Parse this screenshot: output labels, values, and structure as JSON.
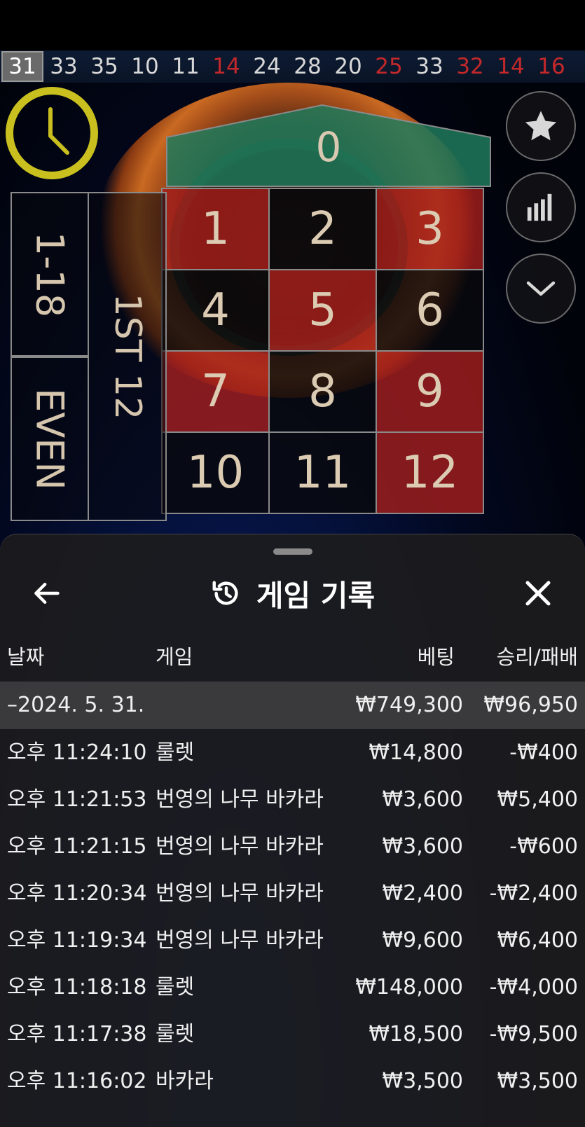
{
  "recent_numbers": [
    {
      "value": "31",
      "color": "current"
    },
    {
      "value": "33",
      "color": "black"
    },
    {
      "value": "35",
      "color": "black"
    },
    {
      "value": "10",
      "color": "black"
    },
    {
      "value": "11",
      "color": "black"
    },
    {
      "value": "14",
      "color": "red"
    },
    {
      "value": "24",
      "color": "black"
    },
    {
      "value": "28",
      "color": "black"
    },
    {
      "value": "20",
      "color": "black"
    },
    {
      "value": "25",
      "color": "red"
    },
    {
      "value": "33",
      "color": "black"
    },
    {
      "value": "32",
      "color": "red"
    },
    {
      "value": "14",
      "color": "red"
    },
    {
      "value": "16",
      "color": "red"
    }
  ],
  "table": {
    "zero": "0",
    "numbers": [
      {
        "n": "1",
        "c": "red"
      },
      {
        "n": "2",
        "c": "black"
      },
      {
        "n": "3",
        "c": "red"
      },
      {
        "n": "4",
        "c": "black"
      },
      {
        "n": "5",
        "c": "red"
      },
      {
        "n": "6",
        "c": "black"
      },
      {
        "n": "7",
        "c": "red"
      },
      {
        "n": "8",
        "c": "black"
      },
      {
        "n": "9",
        "c": "red"
      },
      {
        "n": "10",
        "c": "black"
      },
      {
        "n": "11",
        "c": "black"
      },
      {
        "n": "12",
        "c": "red"
      }
    ],
    "low_label": "1-18",
    "even_label": "EVEN",
    "dozen_label": "1ST 12"
  },
  "sheet": {
    "title": "게임 기록",
    "icons": {
      "back": "back-arrow-icon",
      "history": "history-icon",
      "close": "close-icon"
    },
    "columns": {
      "date": "날짜",
      "game": "게임",
      "bet": "베팅",
      "result": "승리/패배"
    },
    "summary": {
      "date": "–2024. 5. 31.",
      "bet": "₩749,300",
      "result": "₩96,950"
    },
    "rows": [
      {
        "time": "오후 11:24:10",
        "game": "룰렛",
        "bet": "₩14,800",
        "result": "-₩400"
      },
      {
        "time": "오후 11:21:53",
        "game": "번영의 나무 바카라",
        "bet": "₩3,600",
        "result": "₩5,400"
      },
      {
        "time": "오후 11:21:15",
        "game": "번영의 나무 바카라",
        "bet": "₩3,600",
        "result": "-₩600"
      },
      {
        "time": "오후 11:20:34",
        "game": "번영의 나무 바카라",
        "bet": "₩2,400",
        "result": "-₩2,400"
      },
      {
        "time": "오후 11:19:34",
        "game": "번영의 나무 바카라",
        "bet": "₩9,600",
        "result": "₩6,400"
      },
      {
        "time": "오후 11:18:18",
        "game": "룰렛",
        "bet": "₩148,000",
        "result": "-₩4,000"
      },
      {
        "time": "오후 11:17:38",
        "game": "룰렛",
        "bet": "₩18,500",
        "result": "-₩9,500"
      },
      {
        "time": "오후 11:16:02",
        "game": "바카라",
        "bet": "₩3,500",
        "result": "₩3,500"
      }
    ]
  },
  "colors": {
    "red": "#c3282a",
    "felt_green": "#1f7a5c",
    "timer": "#c9c020"
  }
}
